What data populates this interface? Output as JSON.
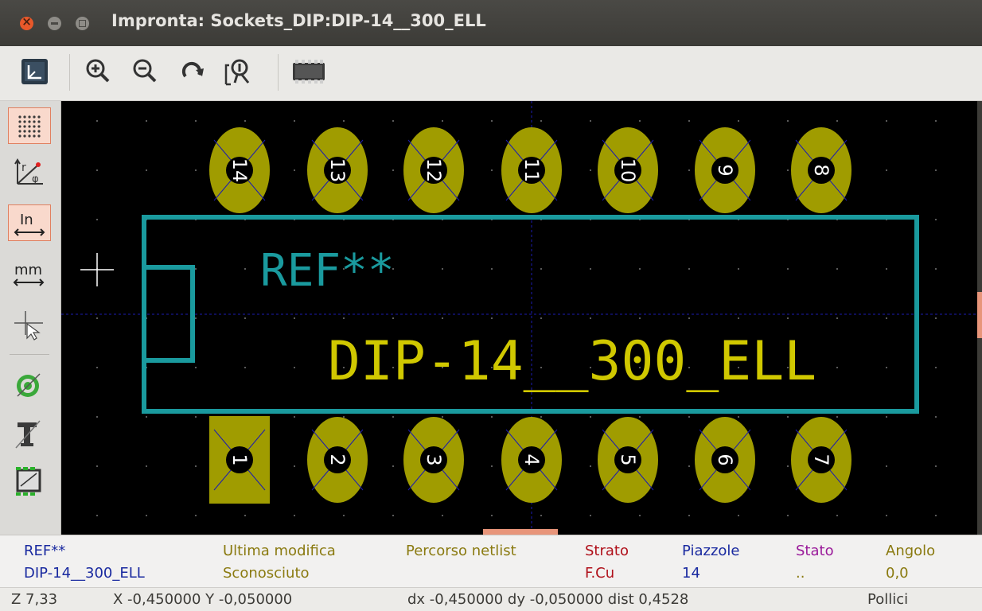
{
  "window": {
    "title": "Impronta: Sockets_DIP:DIP-14__300_ELL"
  },
  "toolbar": {
    "buttons": [
      "display-options",
      "zoom-in",
      "zoom-out",
      "redraw",
      "zoom-auto",
      "show-3d-footprint"
    ]
  },
  "left_toolbar": {
    "buttons": [
      "grid-display",
      "polar-coordinates",
      "units-inches",
      "units-mm",
      "full-cursor",
      "pad-sketch",
      "text-sketch",
      "edge-sketch"
    ],
    "labels": {
      "units_inches": "In",
      "units_mm": "mm",
      "polar_r": "r",
      "polar_phi": "φ"
    }
  },
  "canvas": {
    "reference_text": "REF**",
    "value_text": "DIP-14__300_ELL",
    "top_pads": [
      "14",
      "13",
      "12",
      "11",
      "10",
      "9",
      "8"
    ],
    "bottom_pads": [
      "1",
      "2",
      "3",
      "4",
      "5",
      "6",
      "7"
    ],
    "colors": {
      "background": "#000000",
      "pad": "#a09c00",
      "silkscreen": "#1a9a9e",
      "value_text": "#d0c800",
      "grid_dot": "#5a5a5a",
      "axis": "#1c1cb0"
    }
  },
  "message_panel": {
    "columns": [
      {
        "header": "REF**",
        "value": "DIP-14__300_ELL",
        "header_color": "#1a2aa0",
        "value_color": "#1a2aa0"
      },
      {
        "header": "Ultima modifica",
        "value": "Sconosciuto",
        "header_color": "#8a7a10",
        "value_color": "#8a7a10"
      },
      {
        "header": "Percorso netlist",
        "value": "",
        "header_color": "#8a7a10",
        "value_color": "#8a7a10"
      },
      {
        "header": "Strato",
        "value": "F.Cu",
        "header_color": "#b0101a",
        "value_color": "#b0101a"
      },
      {
        "header": "Piazzole",
        "value": "14",
        "header_color": "#1a2aa0",
        "value_color": "#1a2aa0"
      },
      {
        "header": "Stato",
        "value": "..",
        "header_color": "#9a1a9a",
        "value_color": "#8a7a10"
      },
      {
        "header": "Angolo",
        "value": "0,0",
        "header_color": "#8a7a10",
        "value_color": "#8a7a10"
      }
    ]
  },
  "status_bar": {
    "zoom": "Z 7,33",
    "xy": "X -0,450000  Y -0,050000",
    "delta": "dx -0,450000  dy -0,050000  dist 0,4528",
    "units": "Pollici"
  }
}
